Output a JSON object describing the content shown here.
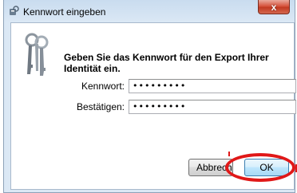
{
  "window": {
    "title": "Kennwort eingeben",
    "title_icon": "key-window-icon",
    "close_label": "x",
    "close_icon": "close-icon"
  },
  "dialog": {
    "icon": "keys-icon",
    "heading": "Geben Sie das Kennwort für den Export Ihrer Identität ein.",
    "fields": {
      "password_label": "Kennwort:",
      "password_value": "•••••••••",
      "confirm_label": "Bestätigen:",
      "confirm_value": "•••••••••"
    },
    "buttons": {
      "cancel_label": "Abbrechen",
      "ok_label": "OK"
    }
  },
  "annotation": {
    "color": "#e01818",
    "target": "ok-button"
  }
}
